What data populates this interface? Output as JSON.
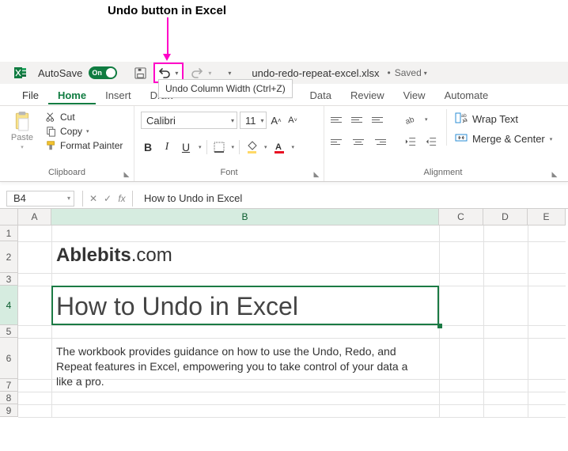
{
  "annotation": {
    "label": "Undo button in Excel"
  },
  "titlebar": {
    "autosave_label": "AutoSave",
    "autosave_state": "On",
    "filename": "undo-redo-repeat-excel.xlsx",
    "saved_label": "Saved",
    "tooltip": "Undo Column Width (Ctrl+Z)"
  },
  "tabs": {
    "file": "File",
    "home": "Home",
    "insert": "Insert",
    "draw": "Draw",
    "data": "Data",
    "review": "Review",
    "view": "View",
    "automate": "Automate"
  },
  "ribbon": {
    "clipboard": {
      "paste": "Paste",
      "cut": "Cut",
      "copy": "Copy",
      "format_painter": "Format Painter",
      "group": "Clipboard"
    },
    "font": {
      "name": "Calibri",
      "size": "11",
      "b": "B",
      "i": "I",
      "u": "U",
      "group": "Font"
    },
    "alignment": {
      "wrap": "Wrap Text",
      "merge": "Merge & Center",
      "group": "Alignment"
    }
  },
  "formula_bar": {
    "cell_ref": "B4",
    "fx": "fx",
    "value": "How to Undo in Excel"
  },
  "sheet": {
    "cols": [
      "A",
      "B",
      "C",
      "D",
      "E"
    ],
    "rows": [
      "1",
      "2",
      "3",
      "4",
      "5",
      "6",
      "7",
      "8",
      "9"
    ],
    "ablebits_bold": "Ablebits",
    "ablebits_rest": ".com",
    "title": "How to Undo in Excel",
    "desc": "The workbook provides guidance on how to use the Undo, Redo, and Repeat features in Excel, empowering you to take control of your data a like a pro."
  }
}
